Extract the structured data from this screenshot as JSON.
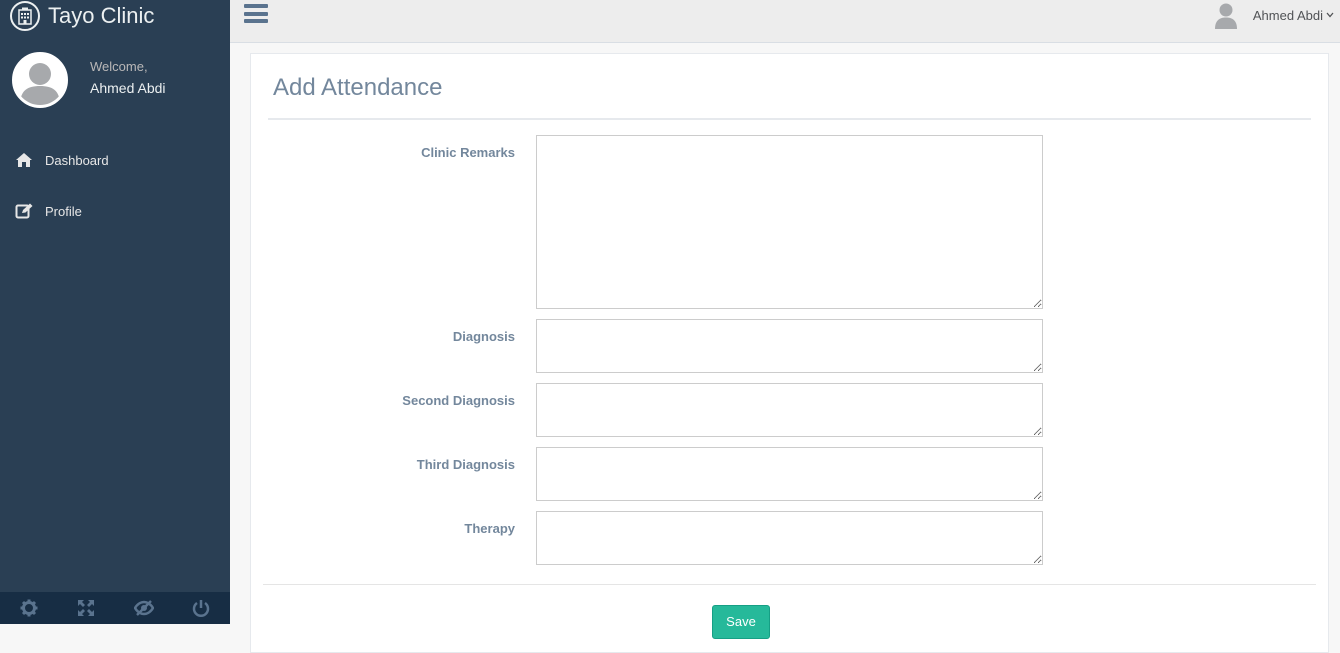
{
  "brand": {
    "title": "Tayo Clinic",
    "icon": "hospital-icon"
  },
  "sidebar": {
    "welcome_label": "Welcome,",
    "user_name": "Ahmed Abdi",
    "menu": [
      {
        "label": "Dashboard",
        "icon": "home-icon"
      },
      {
        "label": "Profile",
        "icon": "edit-icon"
      }
    ],
    "footer_icons": [
      "settings-icon",
      "fullscreen-icon",
      "lock-icon",
      "logout-icon"
    ]
  },
  "topbar": {
    "menu_icon": "hamburger-menu-icon",
    "user_name": "Ahmed Abdi"
  },
  "form": {
    "title": "Add Attendance",
    "fields": [
      {
        "label": "Clinic Remarks",
        "value": ""
      },
      {
        "label": "Diagnosis",
        "value": ""
      },
      {
        "label": "Second Diagnosis",
        "value": ""
      },
      {
        "label": "Third Diagnosis",
        "value": ""
      },
      {
        "label": "Therapy",
        "value": ""
      }
    ],
    "save_label": "Save"
  },
  "colors": {
    "sidebar_bg": "#2A3F54",
    "sidebar_footer_bg": "#172D44",
    "topbar_bg": "#EDEDED",
    "accent_green": "#26B99A",
    "label_color": "#73879C"
  }
}
